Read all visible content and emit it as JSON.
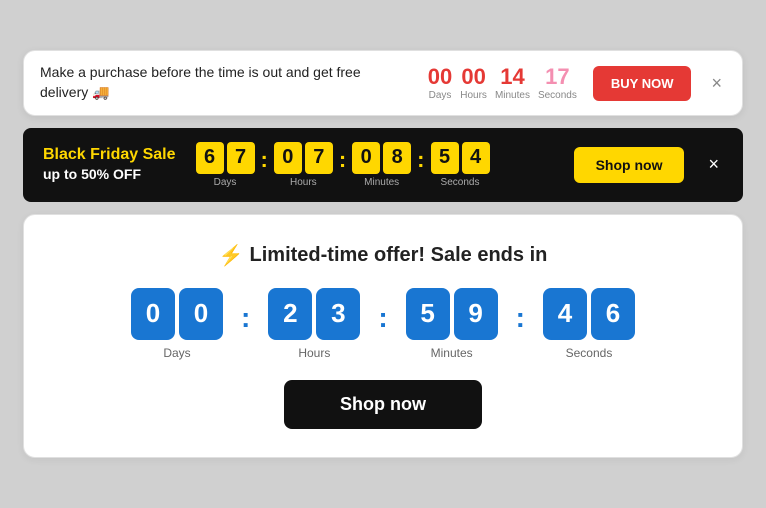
{
  "banner1": {
    "text": "Make a purchase before the time is out and get free delivery 🚚",
    "countdown": {
      "days": {
        "value": "00",
        "label": "Days"
      },
      "hours": {
        "value": "00",
        "label": "Hours"
      },
      "minutes": {
        "value": "14",
        "label": "Minutes"
      },
      "seconds": {
        "value": "17",
        "label": "Seconds"
      }
    },
    "buy_label": "BUY NOW",
    "close_icon": "×"
  },
  "banner2": {
    "title": "Black Friday Sale",
    "subtitle": "up to 50% OFF",
    "countdown": {
      "days": {
        "d1": "6",
        "d2": "7",
        "label": "Days"
      },
      "hours": {
        "d1": "0",
        "d2": "7",
        "label": "Hours"
      },
      "minutes": {
        "d1": "0",
        "d2": "8",
        "label": "Minutes"
      },
      "seconds": {
        "d1": "5",
        "d2": "4",
        "label": "Seconds"
      }
    },
    "shop_label": "Shop now",
    "close_icon": "×"
  },
  "banner3": {
    "icon": "⚡",
    "title": "Limited-time offer! Sale ends in",
    "countdown": {
      "days": {
        "d1": "0",
        "d2": "0",
        "label": "Days"
      },
      "hours": {
        "d1": "2",
        "d2": "3",
        "label": "Hours"
      },
      "minutes": {
        "d1": "5",
        "d2": "9",
        "label": "Minutes"
      },
      "seconds": {
        "d1": "4",
        "d2": "6",
        "label": "Seconds"
      }
    },
    "shop_label": "Shop now"
  }
}
